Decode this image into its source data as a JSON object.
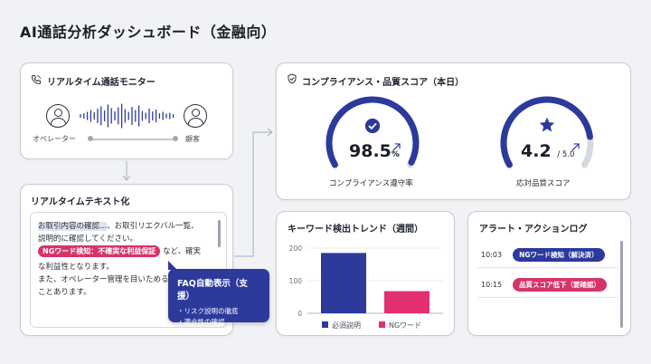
{
  "page": {
    "title": "AI通話分析ダッシュボード（金融向）"
  },
  "monitor": {
    "title": "リアルタイム通話モニター",
    "operator_label": "オペレーター",
    "customer_label": "顧客"
  },
  "transcript": {
    "title": "リアルタイムテキスト化",
    "line1_highlight": "お取引内容の確認...",
    "line1_rest": "、お取引リエクバル一覧、",
    "line2": "説明的に確認してください。",
    "ng_pill": "NGワード検知：不確実な利益保証",
    "line3_rest": "など、確実",
    "line4": "な利益性となります。",
    "line5": "また、オペレーター管理を目いためる",
    "line6": "ことあります。"
  },
  "faq": {
    "title": "FAQ自動表示（支援）",
    "items": [
      "・リスク説明の徹底",
      "・適合性の確認"
    ]
  },
  "scores": {
    "title": "コンプライアンス・品質スコア（本日）",
    "compliance": {
      "value": "98.5",
      "unit": "%",
      "fraction": 0.985,
      "caption": "コンプライアンス遵守率",
      "trend_icon": "up-right-arrow-icon"
    },
    "quality": {
      "value": "4.2",
      "max_label": "/ 5.0",
      "fraction": 0.84,
      "caption": "応対品質スコア",
      "trend_icon": "up-right-arrow-icon"
    }
  },
  "trend": {
    "title": "キーワード検出トレンド（週間）",
    "legend": [
      "必須説明",
      "NGワード"
    ]
  },
  "chart_data": {
    "type": "bar",
    "categories": [
      "必須説明",
      "NGワード"
    ],
    "values": [
      185,
      68
    ],
    "yticks": [
      "200",
      "100",
      "0"
    ],
    "ylim": [
      0,
      200
    ],
    "colors": [
      "#2c3a9c",
      "#e0306f"
    ]
  },
  "alerts": {
    "title": "アラート・アクションログ",
    "rows": [
      {
        "time": "10:03",
        "label": "NGワード検知（解決済）",
        "color": "#2c3a9c"
      },
      {
        "time": "10:15",
        "label": "品質スコア低下（要確認）",
        "color": "#d6336c"
      }
    ]
  },
  "colors": {
    "accent": "#2c3a9c",
    "alert": "#d6336c",
    "track": "#d7d9df"
  }
}
